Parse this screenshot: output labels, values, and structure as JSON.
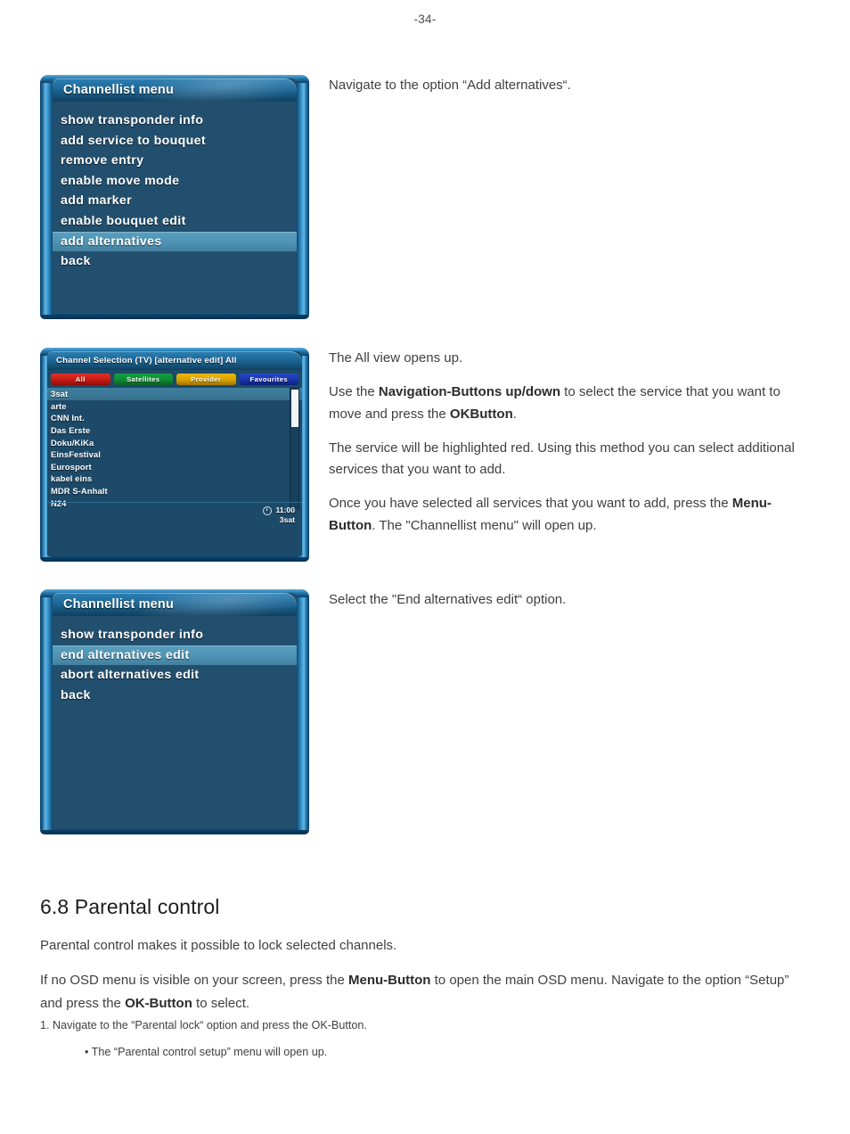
{
  "page": {
    "number": "-34-"
  },
  "step1": {
    "caption": "Navigate to the option “Add alternatives“.",
    "window": {
      "title": "Channellist menu",
      "items": [
        {
          "label": "show transponder info",
          "selected": false
        },
        {
          "label": "add service to bouquet",
          "selected": false
        },
        {
          "label": "remove entry",
          "selected": false
        },
        {
          "label": "enable move mode",
          "selected": false
        },
        {
          "label": "add marker",
          "selected": false
        },
        {
          "label": "enable bouquet edit",
          "selected": false
        },
        {
          "label": "add alternatives",
          "selected": true
        },
        {
          "label": "back",
          "selected": false
        }
      ]
    }
  },
  "step2": {
    "paragraphs": [
      {
        "text": "The All view opens up."
      }
    ],
    "p2_a": "Use the ",
    "p2_b": "Navigation-Buttons up/down",
    "p2_c": " to select the service that you want to move and press the ",
    "p2_d": "OKButton",
    "p2_e": ".",
    "p3": "The service will be highlighted red. Using this method you can select additional services that you want to add.",
    "p4_a": "Once you have selected all services that you want to add, press the ",
    "p4_b": "Menu-Button",
    "p4_c": ". The \"Channellist menu\" will open up.",
    "window": {
      "title": "Channel Selection (TV) [alternative edit] All",
      "buttons": [
        {
          "label": "All",
          "color": "#c41c14",
          "key": "red"
        },
        {
          "label": "Satellites",
          "color": "#0e8a33",
          "key": "green"
        },
        {
          "label": "Provider",
          "color": "#d8a000",
          "key": "yellow"
        },
        {
          "label": "Favourites",
          "color": "#1a35ad",
          "key": "blue"
        }
      ],
      "channels": [
        {
          "name": "3sat",
          "selected": true
        },
        {
          "name": "arte",
          "selected": false
        },
        {
          "name": "CNN Int.",
          "selected": false
        },
        {
          "name": "Das Erste",
          "selected": false
        },
        {
          "name": "Doku/KiKa",
          "selected": false
        },
        {
          "name": "EinsFestival",
          "selected": false
        },
        {
          "name": "Eurosport",
          "selected": false
        },
        {
          "name": "kabel eins",
          "selected": false
        },
        {
          "name": "MDR S-Anhalt",
          "selected": false
        },
        {
          "name": "N24",
          "selected": false
        }
      ],
      "info": {
        "icon": "clock-icon",
        "time": "11:00",
        "service": "3sat"
      }
    }
  },
  "step3": {
    "caption": "Select the \"End alternatives edit“ option.",
    "window": {
      "title": "Channellist menu",
      "items": [
        {
          "label": "show transponder info",
          "selected": false
        },
        {
          "label": "end alternatives edit",
          "selected": true
        },
        {
          "label": "abort alternatives edit",
          "selected": false
        },
        {
          "label": "back",
          "selected": false
        }
      ]
    }
  },
  "section": {
    "heading": "6.8 Parental control",
    "p1": "Parental control makes it possible to lock selected channels.",
    "p2_a": "If no OSD menu is visible on your screen, press the ",
    "p2_b": "Menu-Button",
    "p2_c": " to open the main OSD menu. Navigate to the option “Setup” and press the ",
    "p2_d": "OK-Button",
    "p2_e": " to select.",
    "numbered_step": "1. Navigate to the “Parental lock“ option and press the OK-Button.",
    "bullet": "• The “Parental control setup” menu will open up."
  },
  "colors": {
    "osd_body": "#224f6d",
    "osd_highlight": "#4e93b4",
    "osd_frame": "#0d4871",
    "cs_body": "#1d4a68",
    "text": "#3f3f3f"
  }
}
